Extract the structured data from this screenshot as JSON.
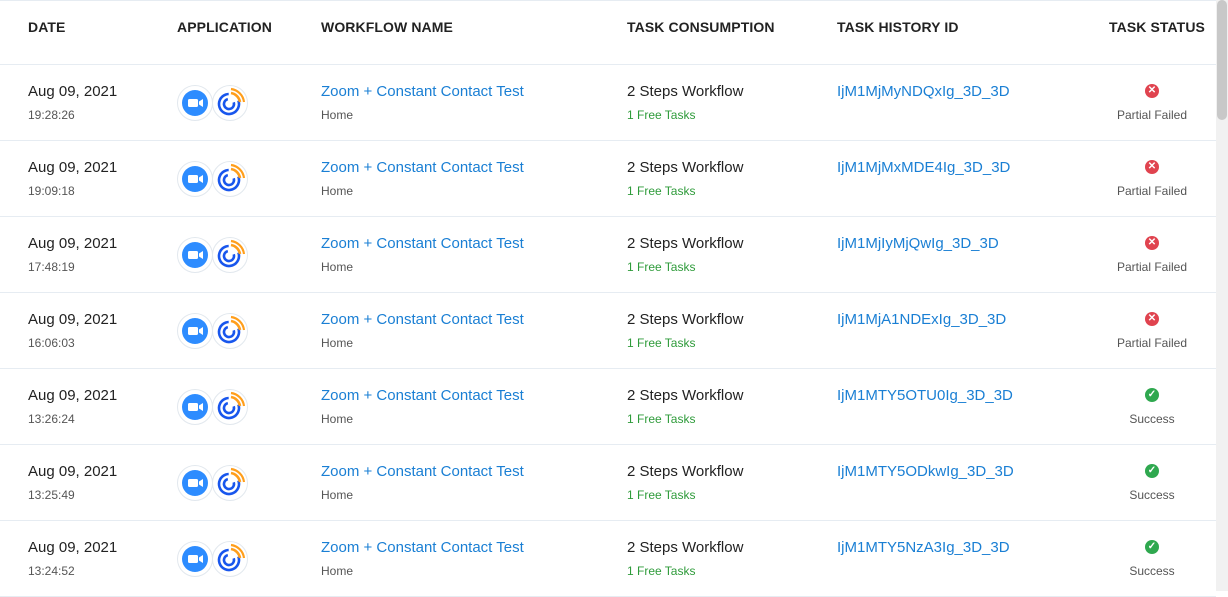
{
  "headers": {
    "date": "DATE",
    "application": "APPLICATION",
    "workflow_name": "WORKFLOW NAME",
    "task_consumption": "TASK CONSUMPTION",
    "task_history_id": "TASK HISTORY ID",
    "task_status": "TASK STATUS"
  },
  "colors": {
    "link": "#1a7fd4",
    "free_tasks": "#2e9b3a",
    "failed": "#e0434f",
    "success": "#2fa84f",
    "zoom": "#2d8cff",
    "constant_contact_blue": "#1856ed",
    "constant_contact_orange": "#ff9e1b"
  },
  "apps": [
    "zoom-icon",
    "constant-contact-icon"
  ],
  "rows": [
    {
      "date": "Aug 09, 2021",
      "time": "19:28:26",
      "workflow": "Zoom + Constant Contact Test",
      "folder": "Home",
      "consumption": "2 Steps Workflow",
      "free": "1 Free Tasks",
      "history_id": "IjM1MjMyNDQxIg_3D_3D",
      "status": "Partial Failed",
      "status_type": "failed"
    },
    {
      "date": "Aug 09, 2021",
      "time": "19:09:18",
      "workflow": "Zoom + Constant Contact Test",
      "folder": "Home",
      "consumption": "2 Steps Workflow",
      "free": "1 Free Tasks",
      "history_id": "IjM1MjMxMDE4Ig_3D_3D",
      "status": "Partial Failed",
      "status_type": "failed"
    },
    {
      "date": "Aug 09, 2021",
      "time": "17:48:19",
      "workflow": "Zoom + Constant Contact Test",
      "folder": "Home",
      "consumption": "2 Steps Workflow",
      "free": "1 Free Tasks",
      "history_id": "IjM1MjIyMjQwIg_3D_3D",
      "status": "Partial Failed",
      "status_type": "failed"
    },
    {
      "date": "Aug 09, 2021",
      "time": "16:06:03",
      "workflow": "Zoom + Constant Contact Test",
      "folder": "Home",
      "consumption": "2 Steps Workflow",
      "free": "1 Free Tasks",
      "history_id": "IjM1MjA1NDExIg_3D_3D",
      "status": "Partial Failed",
      "status_type": "failed"
    },
    {
      "date": "Aug 09, 2021",
      "time": "13:26:24",
      "workflow": "Zoom + Constant Contact Test",
      "folder": "Home",
      "consumption": "2 Steps Workflow",
      "free": "1 Free Tasks",
      "history_id": "IjM1MTY5OTU0Ig_3D_3D",
      "status": "Success",
      "status_type": "success"
    },
    {
      "date": "Aug 09, 2021",
      "time": "13:25:49",
      "workflow": "Zoom + Constant Contact Test",
      "folder": "Home",
      "consumption": "2 Steps Workflow",
      "free": "1 Free Tasks",
      "history_id": "IjM1MTY5ODkwIg_3D_3D",
      "status": "Success",
      "status_type": "success"
    },
    {
      "date": "Aug 09, 2021",
      "time": "13:24:52",
      "workflow": "Zoom + Constant Contact Test",
      "folder": "Home",
      "consumption": "2 Steps Workflow",
      "free": "1 Free Tasks",
      "history_id": "IjM1MTY5NzA3Ig_3D_3D",
      "status": "Success",
      "status_type": "success"
    }
  ]
}
